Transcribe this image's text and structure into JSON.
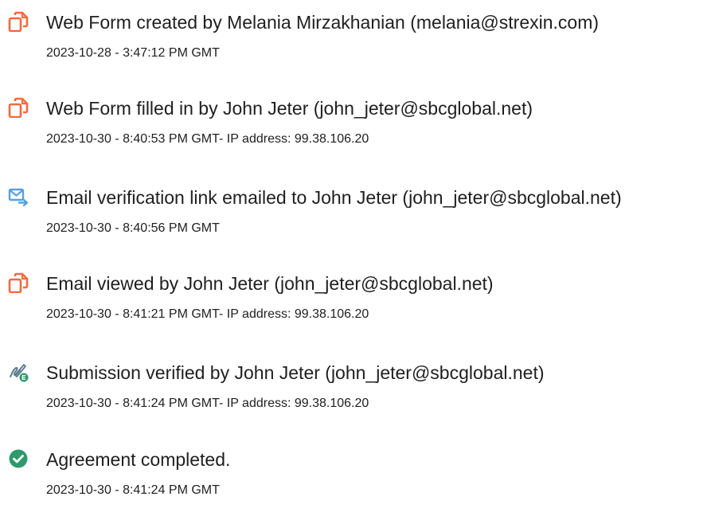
{
  "events": [
    {
      "icon": "pdf-document-icon",
      "title": "Web Form created by Melania Mirzakhanian (melania@strexin.com)",
      "meta": "2023-10-28 - 3:47:12 PM GMT"
    },
    {
      "icon": "pdf-document-icon",
      "title": "Web Form filled in by John Jeter (john_jeter@sbcglobal.net)",
      "meta": "2023-10-30 - 8:40:53 PM GMT- IP address: 99.38.106.20"
    },
    {
      "icon": "email-send-icon",
      "title": "Email verification link emailed to John Jeter (john_jeter@sbcglobal.net)",
      "meta": "2023-10-30 - 8:40:56 PM GMT"
    },
    {
      "icon": "pdf-document-icon",
      "title": "Email viewed by John Jeter (john_jeter@sbcglobal.net)",
      "meta": "2023-10-30 - 8:41:21 PM GMT- IP address: 99.38.106.20"
    },
    {
      "icon": "verified-signature-icon",
      "title": "Submission verified by John Jeter (john_jeter@sbcglobal.net)",
      "meta": "2023-10-30 - 8:41:24 PM GMT- IP address: 99.38.106.20"
    },
    {
      "icon": "check-circle-icon",
      "title": "Agreement completed.",
      "meta": "2023-10-30 - 8:41:24 PM GMT"
    }
  ],
  "colors": {
    "pdf_icon": "#f26b3a",
    "email_icon": "#5aa0d8",
    "signature_icon": "#5b7a8c",
    "signature_badge": "#2e9a6b",
    "check_icon": "#2e9a6b"
  }
}
